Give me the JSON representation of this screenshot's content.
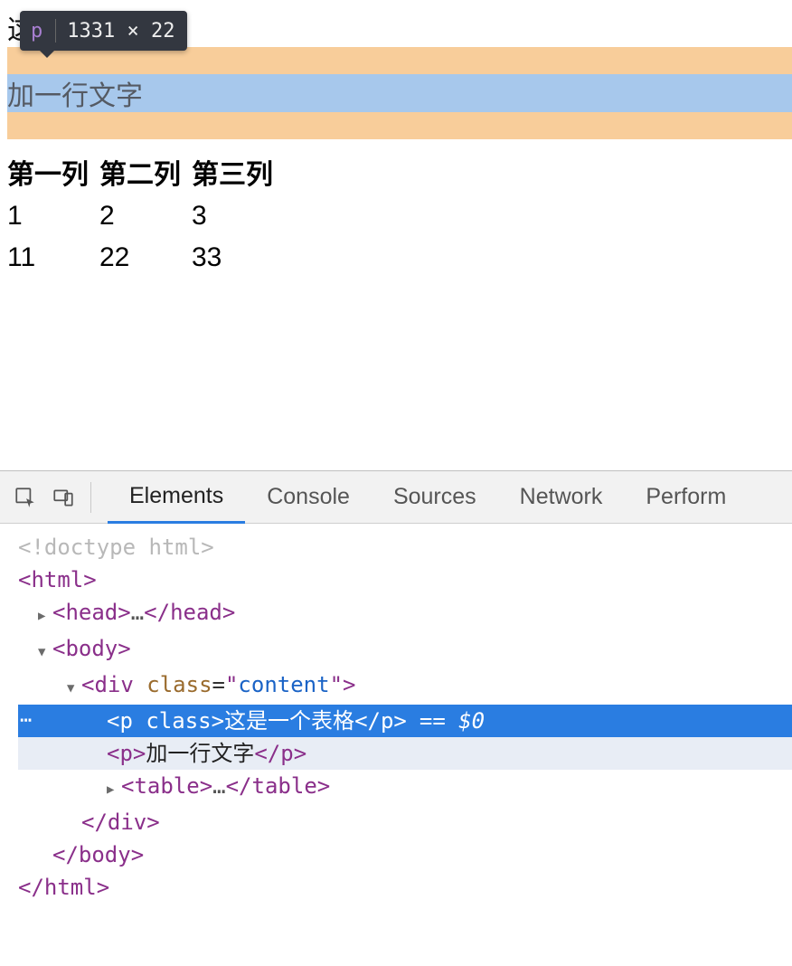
{
  "tooltip": {
    "tag": "p",
    "dimensions": "1331 × 22"
  },
  "page_content": {
    "paragraph1": "这是一个表格",
    "paragraph2": "加一行文字",
    "table": {
      "headers": [
        "第一列",
        "第二列",
        "第三列"
      ],
      "rows": [
        [
          "1",
          "2",
          "3"
        ],
        [
          "11",
          "22",
          "33"
        ]
      ]
    }
  },
  "devtools": {
    "tabs": [
      "Elements",
      "Console",
      "Sources",
      "Network",
      "Perform"
    ],
    "active_tab": 0,
    "selection_marker": "== $0",
    "dom": {
      "doctype": "<!doctype html>",
      "html_open": "html",
      "head": {
        "tag": "head",
        "collapsed_marker": "…"
      },
      "body_open": "body",
      "div": {
        "tag": "div",
        "attr_name": "class",
        "attr_value": "content"
      },
      "p_selected": {
        "tag": "p",
        "empty_attr": "class",
        "text": "这是一个表格"
      },
      "p_hover": {
        "tag": "p",
        "text": "加一行文字"
      },
      "table_collapsed": {
        "tag": "table",
        "collapsed_marker": "…"
      },
      "div_close": "div",
      "body_close": "body",
      "html_close": "html"
    }
  }
}
